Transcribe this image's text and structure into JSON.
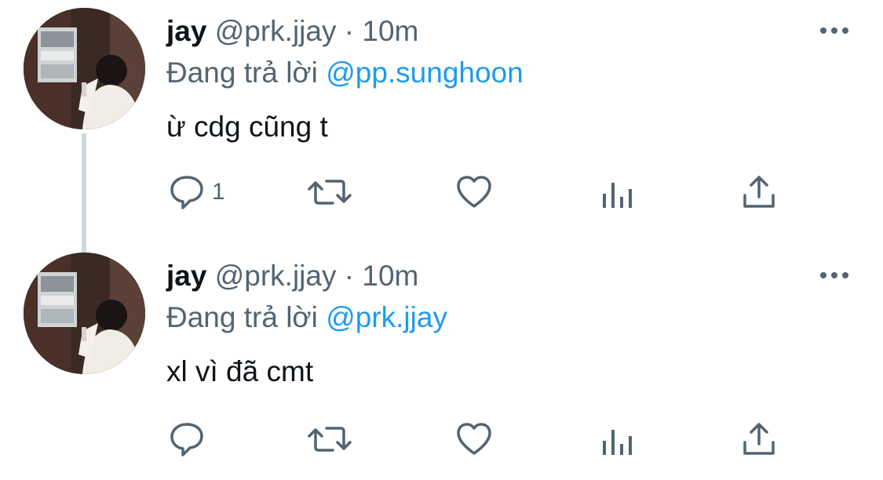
{
  "thread": {
    "tweets": [
      {
        "author": {
          "name": "jay",
          "handle": "@prk.jjay"
        },
        "separator": "·",
        "time": "10m",
        "replying_label": "Đang trả lời",
        "replying_to": "@pp.sunghoon",
        "text": "ừ cdg cũng t",
        "actions": {
          "reply_count": "1"
        }
      },
      {
        "author": {
          "name": "jay",
          "handle": "@prk.jjay"
        },
        "separator": "·",
        "time": "10m",
        "replying_label": "Đang trả lời",
        "replying_to": "@prk.jjay",
        "text": "xl vì đã cmt",
        "actions": {
          "reply_count": ""
        }
      }
    ]
  },
  "icons": {
    "more": "more-dots-icon",
    "reply": "reply-bubble-icon",
    "retweet": "retweet-icon",
    "like": "heart-icon",
    "views": "analytics-bars-icon",
    "share": "share-upload-icon"
  },
  "colors": {
    "text_primary": "#0f1419",
    "text_secondary": "#536471",
    "link": "#1d9bf0",
    "thread_line": "#cfd9de"
  }
}
